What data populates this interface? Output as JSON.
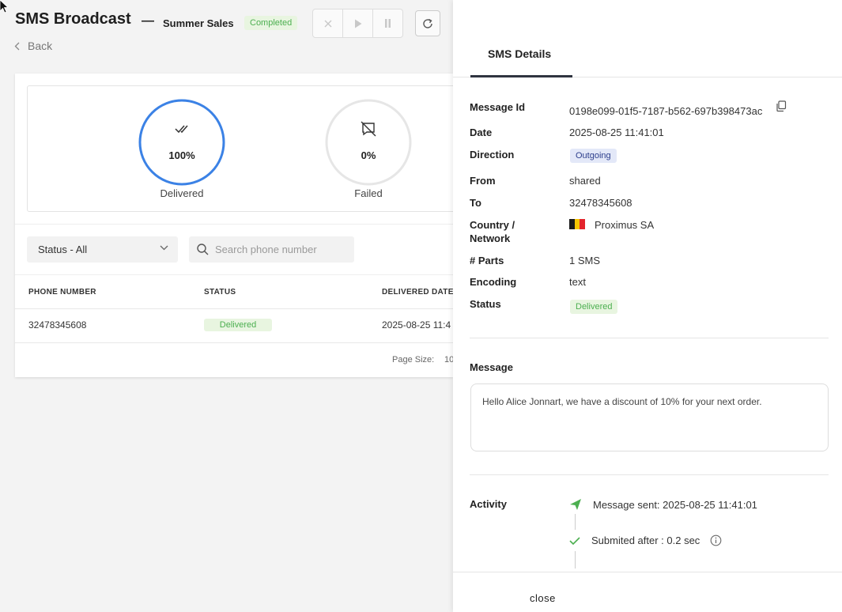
{
  "header": {
    "title": "SMS Broadcast",
    "dash": "—",
    "campaign_name": "Summer Sales",
    "status_badge": "Completed",
    "back_label": "Back"
  },
  "stats": [
    {
      "label": "Delivered",
      "percent_text": "100%",
      "percent": 100,
      "color": "#3b82e6"
    },
    {
      "label": "Failed",
      "percent_text": "0%",
      "percent": 0,
      "color": "#e0e0e0"
    }
  ],
  "filters": {
    "status_select": "Status - All",
    "search_placeholder": "Search phone number"
  },
  "table": {
    "columns": [
      "PHONE NUMBER",
      "STATUS",
      "DELIVERED DATE"
    ],
    "rows": [
      {
        "phone": "32478345608",
        "status": "Delivered",
        "delivered_date": "2025-08-25 11:4"
      }
    ],
    "page_size_label": "Page Size:",
    "page_size_value": "10"
  },
  "drawer": {
    "tab": "SMS Details",
    "details": {
      "message_id_label": "Message Id",
      "message_id": "0198e099-01f5-7187-b562-697b398473ac",
      "date_label": "Date",
      "date": "2025-08-25 11:41:01",
      "direction_label": "Direction",
      "direction": "Outgoing",
      "from_label": "From",
      "from": "shared",
      "to_label": "To",
      "to": "32478345608",
      "country_label_1": "Country /",
      "country_label_2": "Network",
      "network": "Proximus SA",
      "flag_colors": [
        "#1a1a1a",
        "#f5c400",
        "#e3242b"
      ],
      "parts_label": "# Parts",
      "parts": "1 SMS",
      "encoding_label": "Encoding",
      "encoding": "text",
      "status_label": "Status",
      "status": "Delivered"
    },
    "message_label": "Message",
    "message": "Hello Alice Jonnart, we have a discount of 10% for your next order.",
    "activity_label": "Activity",
    "activity": [
      {
        "icon": "send-icon",
        "text": "Message sent: 2025-08-25 11:41:01"
      },
      {
        "icon": "check-icon",
        "text": "Submited after : 0.2 sec"
      }
    ],
    "close_label": "close"
  }
}
